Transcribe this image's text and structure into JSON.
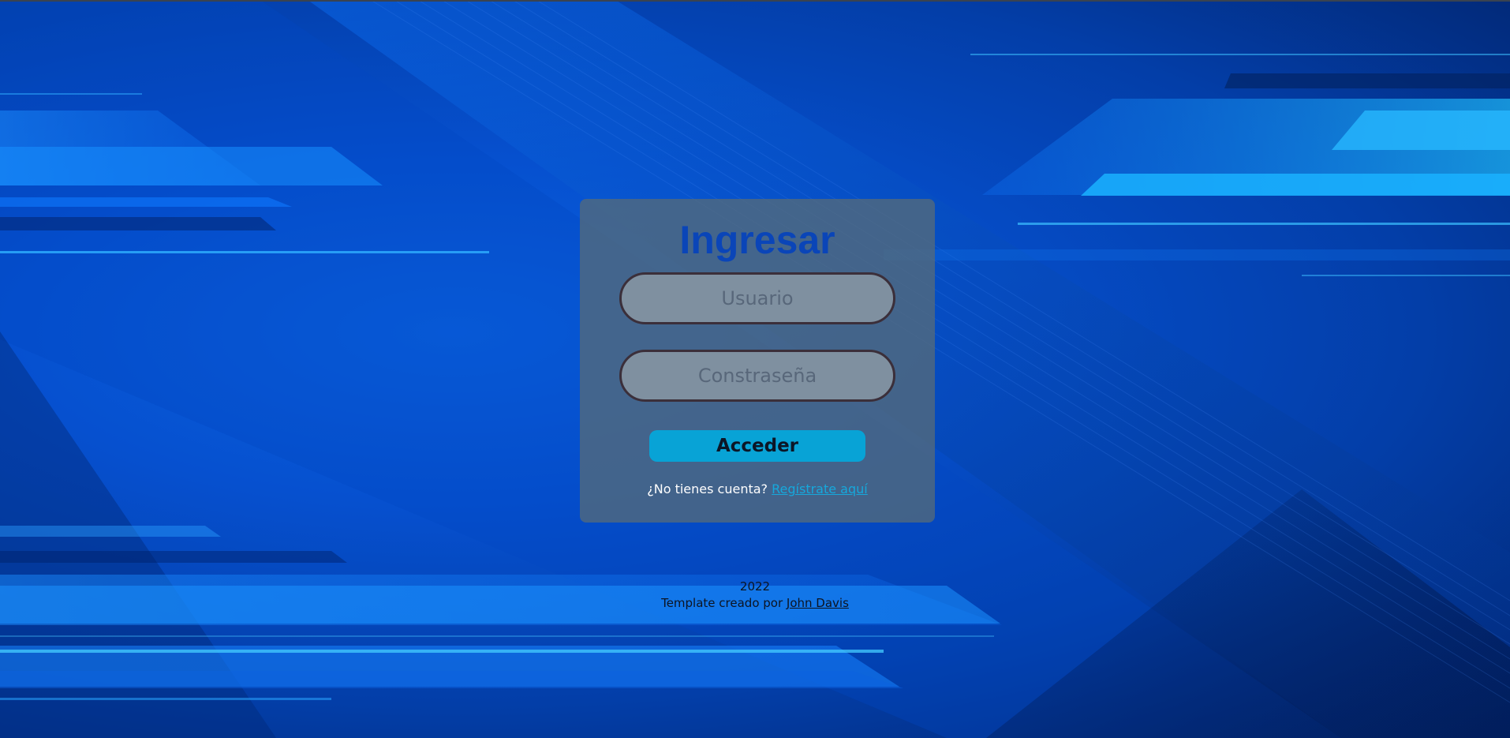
{
  "login": {
    "title": "Ingresar",
    "username_placeholder": "Usuario",
    "password_placeholder": "Constraseña",
    "submit_label": "Acceder",
    "register_prompt": "¿No tienes cuenta?",
    "register_link": "Regístrate aquí"
  },
  "footer": {
    "year": "2022",
    "credit_text": "Template creado por",
    "author_link": "John Davis"
  },
  "colors": {
    "title": "#0a45b8",
    "button": "#08a3d6",
    "link": "#16a8dc"
  }
}
